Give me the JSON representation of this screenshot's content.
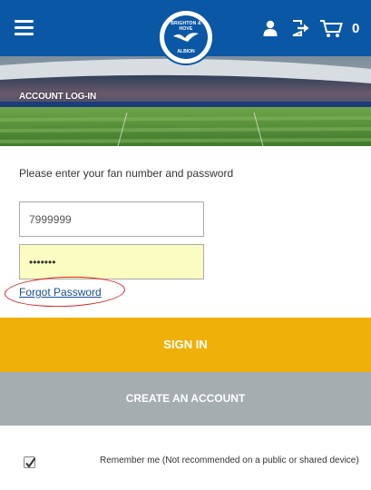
{
  "header": {
    "logo_text_top": "BRIGHTON & HOVE",
    "logo_text_bottom": "ALBION",
    "cart_count": "0"
  },
  "banner": {
    "title": "ACCOUNT LOG-IN"
  },
  "form": {
    "instructions": "Please enter your fan number and password",
    "fan_number_value": "7999999",
    "password_value": "•••••••",
    "forgot_password": "Forgot Password",
    "sign_in": "SIGN IN",
    "create_account": "CREATE AN ACCOUNT",
    "remember_me_checked": true,
    "remember_me_label": "Remember me (Not recommended on a public or shared device)"
  },
  "colors": {
    "header_blue": "#0a57a5",
    "sign_in_yellow": "#efb00a",
    "create_grey": "#a5adb1",
    "password_bg": "#fafcc1",
    "annotation_red": "#d42424"
  }
}
